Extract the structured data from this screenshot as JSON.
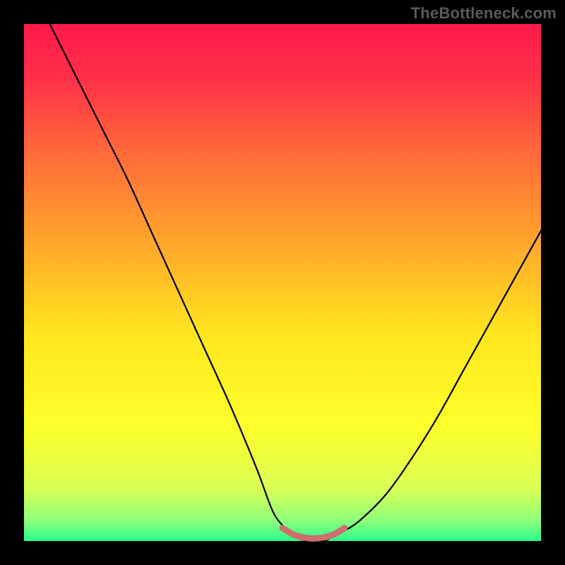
{
  "watermark": "TheBottleneck.com",
  "chart_data": {
    "type": "line",
    "title": "",
    "xlabel": "",
    "ylabel": "",
    "xlim": [
      0,
      100
    ],
    "ylim": [
      0,
      100
    ],
    "grid": false,
    "legend": false,
    "annotations": [],
    "background_gradient": {
      "stops": [
        {
          "offset": 0.0,
          "color": "#ff1a4b"
        },
        {
          "offset": 0.1,
          "color": "#ff2e49"
        },
        {
          "offset": 0.25,
          "color": "#ff6a3a"
        },
        {
          "offset": 0.45,
          "color": "#ffb029"
        },
        {
          "offset": 0.6,
          "color": "#ffe61e"
        },
        {
          "offset": 0.78,
          "color": "#fdff2a"
        },
        {
          "offset": 0.9,
          "color": "#d8ff55"
        },
        {
          "offset": 0.96,
          "color": "#8eff7a"
        },
        {
          "offset": 1.0,
          "color": "#29ff8c"
        }
      ]
    },
    "series": [
      {
        "name": "bottleneck-curve",
        "color": "#000000",
        "width": 2.2,
        "x": [
          5,
          10,
          15,
          20,
          25,
          30,
          35,
          40,
          45,
          48,
          50,
          52,
          55,
          58,
          60,
          62,
          65,
          70,
          75,
          80,
          85,
          90,
          95,
          100
        ],
        "values": [
          100,
          90,
          80,
          70,
          59,
          48,
          37,
          26,
          14,
          6,
          3,
          1,
          0,
          0,
          1,
          2,
          4,
          9,
          16,
          24,
          33,
          42,
          51,
          60
        ]
      },
      {
        "name": "optimal-band",
        "color": "#cc6f6d",
        "width": 9,
        "x": [
          50,
          52,
          54,
          56,
          58,
          60,
          62
        ],
        "values": [
          2.5,
          1.3,
          0.7,
          0.5,
          0.7,
          1.3,
          2.5
        ]
      }
    ]
  }
}
